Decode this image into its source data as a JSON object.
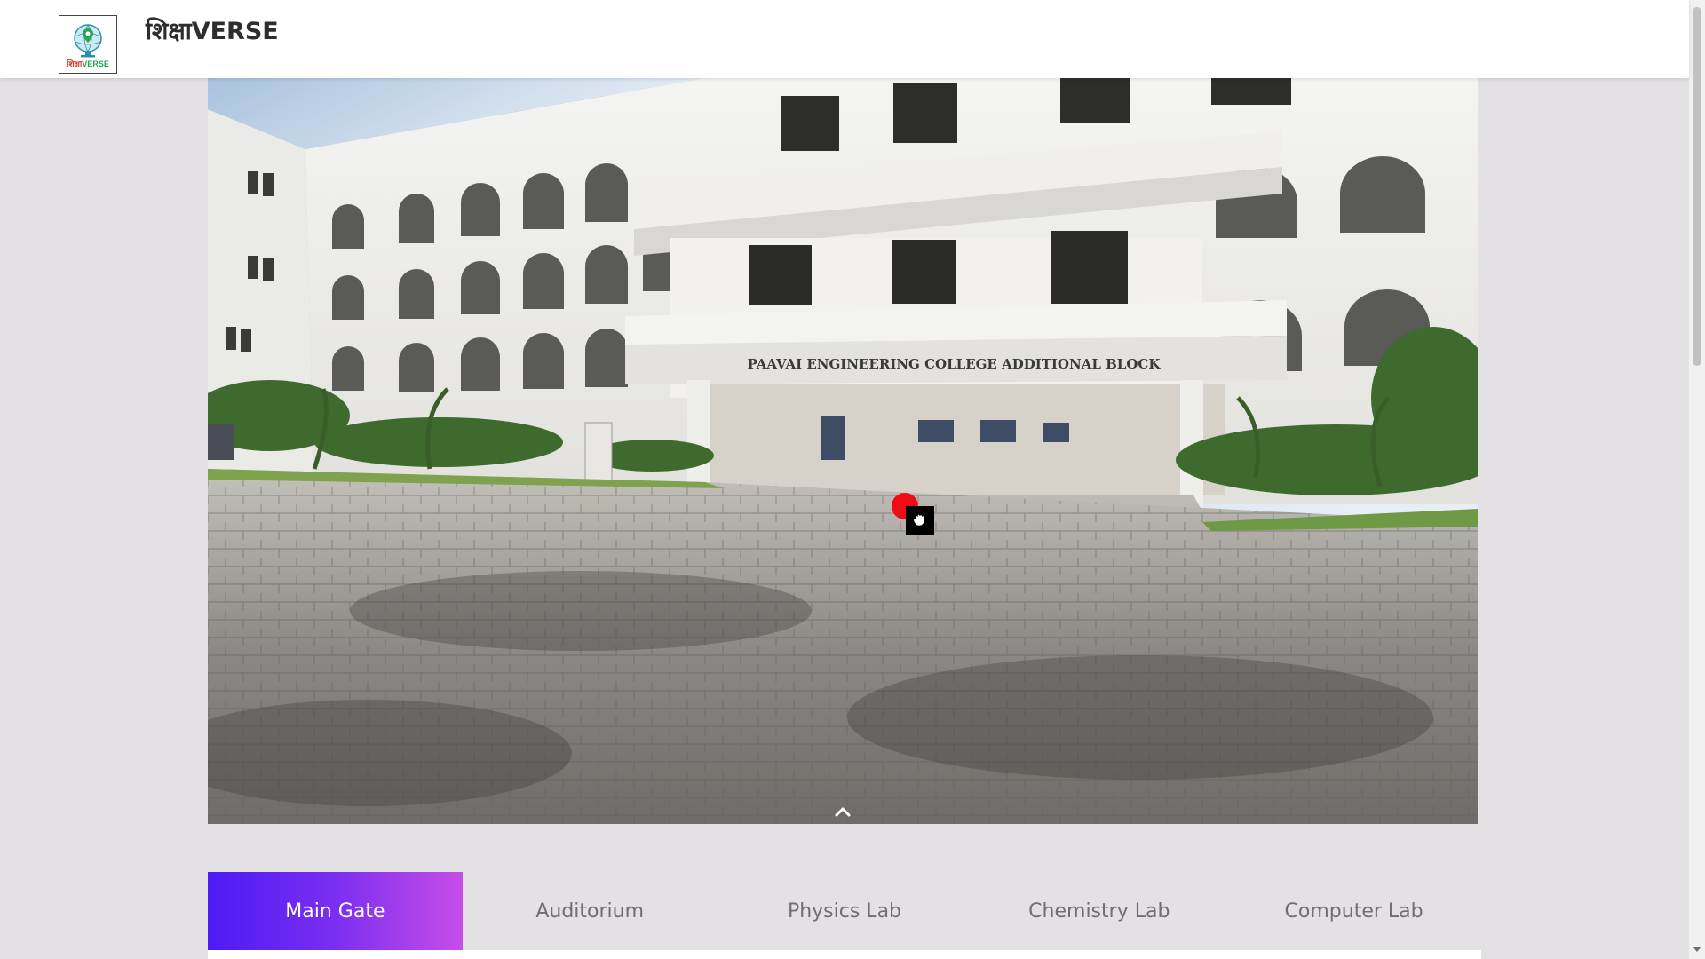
{
  "header": {
    "brand": "शिक्षाVERSE",
    "logo_text_a": "शिक्षा",
    "logo_text_b": "VERSE"
  },
  "scene": {
    "building_sign": "PAAVAI ENGINEERING COLLEGE ADDITIONAL BLOCK"
  },
  "tabs": [
    {
      "label": "Main Gate",
      "active": true
    },
    {
      "label": "Auditorium",
      "active": false
    },
    {
      "label": "Physics Lab",
      "active": false
    },
    {
      "label": "Chemistry Lab",
      "active": false
    },
    {
      "label": "Computer Lab",
      "active": false
    }
  ],
  "colors": {
    "hotspot": "#ee0b12",
    "tab_gradient_start": "#4c1bf5",
    "tab_gradient_end": "#c74de8",
    "page_bg": "#e3e1e3"
  },
  "icons": {
    "hotspot": "red-dot-hotspot",
    "cursor": "grab-hand-icon",
    "nav": "chevron-up-icon"
  }
}
